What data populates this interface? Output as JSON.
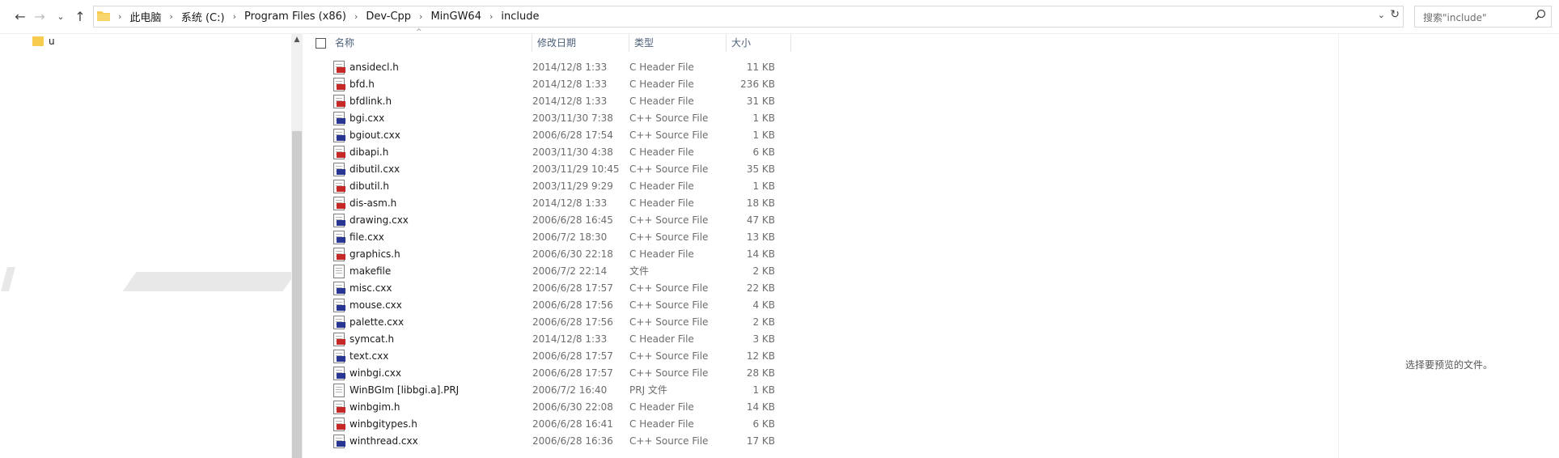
{
  "nav_buttons": {
    "back_icon": "←",
    "forward_icon": "→",
    "recent_icon": "⌄",
    "up_icon": "↑"
  },
  "address": {
    "breadcrumbs": [
      "此电脑",
      "系统 (C:)",
      "Program Files (x86)",
      "Dev-Cpp",
      "MinGW64",
      "include"
    ],
    "separator": "›",
    "dropdown_icon": "⌄",
    "refresh_icon": "↻"
  },
  "search": {
    "placeholder": "搜索\"include\"",
    "icon": "search-icon"
  },
  "navpane": {
    "item_label": "u"
  },
  "columns": {
    "name": "名称",
    "date": "修改日期",
    "type": "类型",
    "size": "大小"
  },
  "files": [
    {
      "name": "ansidecl.h",
      "date": "2014/12/8 1:33",
      "type": "C Header File",
      "size": "11 KB",
      "kind": "h"
    },
    {
      "name": "bfd.h",
      "date": "2014/12/8 1:33",
      "type": "C Header File",
      "size": "236 KB",
      "kind": "h"
    },
    {
      "name": "bfdlink.h",
      "date": "2014/12/8 1:33",
      "type": "C Header File",
      "size": "31 KB",
      "kind": "h"
    },
    {
      "name": "bgi.cxx",
      "date": "2003/11/30 7:38",
      "type": "C++ Source File",
      "size": "1 KB",
      "kind": "cpp"
    },
    {
      "name": "bgiout.cxx",
      "date": "2006/6/28 17:54",
      "type": "C++ Source File",
      "size": "1 KB",
      "kind": "cpp"
    },
    {
      "name": "dibapi.h",
      "date": "2003/11/30 4:38",
      "type": "C Header File",
      "size": "6 KB",
      "kind": "h"
    },
    {
      "name": "dibutil.cxx",
      "date": "2003/11/29 10:45",
      "type": "C++ Source File",
      "size": "35 KB",
      "kind": "cpp"
    },
    {
      "name": "dibutil.h",
      "date": "2003/11/29 9:29",
      "type": "C Header File",
      "size": "1 KB",
      "kind": "h"
    },
    {
      "name": "dis-asm.h",
      "date": "2014/12/8 1:33",
      "type": "C Header File",
      "size": "18 KB",
      "kind": "h"
    },
    {
      "name": "drawing.cxx",
      "date": "2006/6/28 16:45",
      "type": "C++ Source File",
      "size": "47 KB",
      "kind": "cpp"
    },
    {
      "name": "file.cxx",
      "date": "2006/7/2 18:30",
      "type": "C++ Source File",
      "size": "13 KB",
      "kind": "cpp"
    },
    {
      "name": "graphics.h",
      "date": "2006/6/30 22:18",
      "type": "C Header File",
      "size": "14 KB",
      "kind": "h"
    },
    {
      "name": "makefile",
      "date": "2006/7/2 22:14",
      "type": "文件",
      "size": "2 KB",
      "kind": "none"
    },
    {
      "name": "misc.cxx",
      "date": "2006/6/28 17:57",
      "type": "C++ Source File",
      "size": "22 KB",
      "kind": "cpp"
    },
    {
      "name": "mouse.cxx",
      "date": "2006/6/28 17:56",
      "type": "C++ Source File",
      "size": "4 KB",
      "kind": "cpp"
    },
    {
      "name": "palette.cxx",
      "date": "2006/6/28 17:56",
      "type": "C++ Source File",
      "size": "2 KB",
      "kind": "cpp"
    },
    {
      "name": "symcat.h",
      "date": "2014/12/8 1:33",
      "type": "C Header File",
      "size": "3 KB",
      "kind": "h"
    },
    {
      "name": "text.cxx",
      "date": "2006/6/28 17:57",
      "type": "C++ Source File",
      "size": "12 KB",
      "kind": "cpp"
    },
    {
      "name": "winbgi.cxx",
      "date": "2006/6/28 17:57",
      "type": "C++ Source File",
      "size": "28 KB",
      "kind": "cpp"
    },
    {
      "name": "WinBGIm [libbgi.a].PRJ",
      "date": "2006/7/2 16:40",
      "type": "PRJ 文件",
      "size": "1 KB",
      "kind": "none"
    },
    {
      "name": "winbgim.h",
      "date": "2006/6/30 22:08",
      "type": "C Header File",
      "size": "14 KB",
      "kind": "h"
    },
    {
      "name": "winbgitypes.h",
      "date": "2006/6/28 16:41",
      "type": "C Header File",
      "size": "6 KB",
      "kind": "h"
    },
    {
      "name": "winthread.cxx",
      "date": "2006/6/28 16:36",
      "type": "C++ Source File",
      "size": "17 KB",
      "kind": "cpp"
    }
  ],
  "preview": {
    "message": "选择要预览的文件。"
  },
  "colors": {
    "header_text": "#4c607a",
    "folder_yellow": "#f7cb4d",
    "header_badge": "#c62828",
    "cpp_badge": "#283593"
  }
}
